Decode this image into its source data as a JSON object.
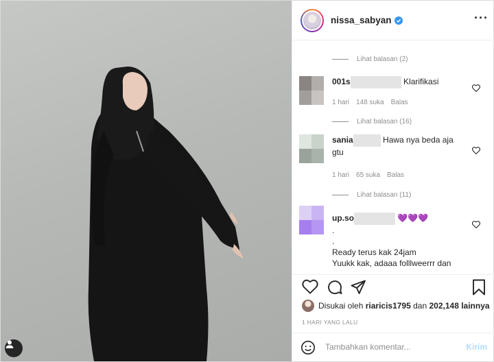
{
  "post": {
    "username": "nissa_sabyan",
    "more_icon": "more-horizontal-icon"
  },
  "comments": [
    {
      "replies_label": "Lihat balasan (2)",
      "user": "001s",
      "text": "Klarifikasi",
      "time": "1 hari",
      "likes": "148 suka",
      "reply": "Balas",
      "avatar_colors": [
        "#8a8583",
        "#b2aeab",
        "#a29e9b",
        "#c8c4c1"
      ]
    },
    {
      "replies_label": "Lihat balasan (16)",
      "user": "sania",
      "text": "Hawa nya beda aja",
      "text_line2": "gtu",
      "time": "1 hari",
      "likes": "65 suka",
      "reply": "Balas",
      "avatar_colors": [
        "#dfe5df",
        "#c8d4c9",
        "#9aa39b",
        "#aab3ab"
      ]
    },
    {
      "replies_label": "Lihat balasan (11)",
      "user": "up.so",
      "hearts": "💜💜💜",
      "lines": [
        ".",
        ".",
        "Ready terus kak 24jam",
        "Yuukk kak, adaaa folllweerrr dan"
      ],
      "avatar_colors": [
        "#ddd0f5",
        "#c9b5f4",
        "#a67ef0",
        "#b596f2"
      ]
    }
  ],
  "liked_by": {
    "prefix": "Disukai oleh",
    "user": "riaricis1795",
    "conj": "dan",
    "count": "202,148 lainnya"
  },
  "timestamp": "1 HARI YANG LALU",
  "add_comment": {
    "placeholder": "Tambahkan komentar...",
    "post_label": "Kirim"
  },
  "colors": {
    "accent": "#3897f0",
    "post_disabled": "#b3dbff",
    "secondary_text": "#8e8e8e"
  }
}
